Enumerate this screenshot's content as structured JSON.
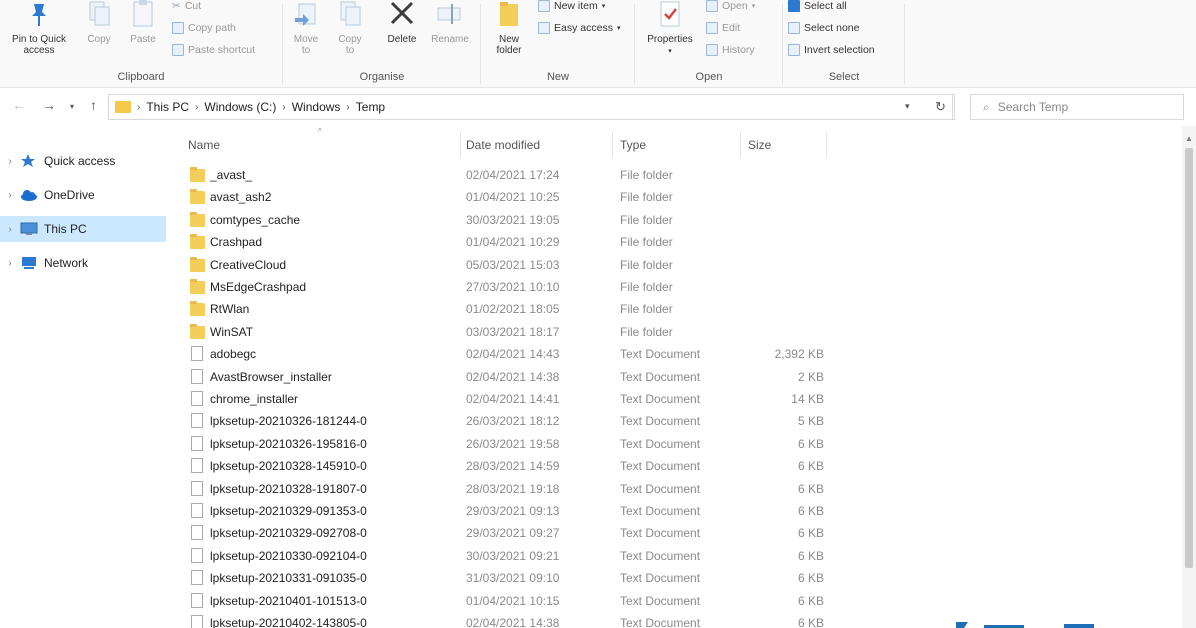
{
  "ribbon": {
    "clipboard": {
      "label": "Clipboard",
      "pin_label_1": "Pin to Quick",
      "pin_label_2": "access",
      "copy": "Copy",
      "paste": "Paste",
      "cut": "Cut",
      "copy_path": "Copy path",
      "paste_shortcut": "Paste shortcut"
    },
    "organise": {
      "label": "Organise",
      "move_to_1": "Move",
      "move_to_2": "to",
      "copy_to_1": "Copy",
      "copy_to_2": "to",
      "delete": "Delete",
      "rename": "Rename"
    },
    "new": {
      "label": "New",
      "new_folder_1": "New",
      "new_folder_2": "folder",
      "new_item": "New item",
      "easy_access": "Easy access"
    },
    "open": {
      "label": "Open",
      "properties": "Properties",
      "open": "Open",
      "edit": "Edit",
      "history": "History"
    },
    "select": {
      "label": "Select",
      "select_all": "Select all",
      "select_none": "Select none",
      "invert_selection": "Invert selection"
    }
  },
  "address": {
    "crumbs": [
      "This PC",
      "Windows (C:)",
      "Windows",
      "Temp"
    ],
    "search_placeholder": "Search Temp"
  },
  "navpane": {
    "items": [
      {
        "label": "Quick access",
        "icon": "star-icon"
      },
      {
        "label": "OneDrive",
        "icon": "cloud-icon"
      },
      {
        "label": "This PC",
        "icon": "computer-icon"
      },
      {
        "label": "Network",
        "icon": "network-icon"
      }
    ]
  },
  "columns": {
    "name": "Name",
    "date": "Date modified",
    "type": "Type",
    "size": "Size"
  },
  "files": [
    {
      "name": "_avast_",
      "date": "02/04/2021 17:24",
      "type": "File folder",
      "size": "",
      "kind": "folder"
    },
    {
      "name": "avast_ash2",
      "date": "01/04/2021 10:25",
      "type": "File folder",
      "size": "",
      "kind": "folder"
    },
    {
      "name": "comtypes_cache",
      "date": "30/03/2021 19:05",
      "type": "File folder",
      "size": "",
      "kind": "folder"
    },
    {
      "name": "Crashpad",
      "date": "01/04/2021 10:29",
      "type": "File folder",
      "size": "",
      "kind": "folder"
    },
    {
      "name": "CreativeCloud",
      "date": "05/03/2021 15:03",
      "type": "File folder",
      "size": "",
      "kind": "folder"
    },
    {
      "name": "MsEdgeCrashpad",
      "date": "27/03/2021 10:10",
      "type": "File folder",
      "size": "",
      "kind": "folder"
    },
    {
      "name": "RtWlan",
      "date": "01/02/2021 18:05",
      "type": "File folder",
      "size": "",
      "kind": "folder"
    },
    {
      "name": "WinSAT",
      "date": "03/03/2021 18:17",
      "type": "File folder",
      "size": "",
      "kind": "folder"
    },
    {
      "name": "adobegc",
      "date": "02/04/2021 14:43",
      "type": "Text Document",
      "size": "2,392 KB",
      "kind": "doc"
    },
    {
      "name": "AvastBrowser_installer",
      "date": "02/04/2021 14:38",
      "type": "Text Document",
      "size": "2 KB",
      "kind": "doc"
    },
    {
      "name": "chrome_installer",
      "date": "02/04/2021 14:41",
      "type": "Text Document",
      "size": "14 KB",
      "kind": "doc"
    },
    {
      "name": "lpksetup-20210326-181244-0",
      "date": "26/03/2021 18:12",
      "type": "Text Document",
      "size": "5 KB",
      "kind": "doc"
    },
    {
      "name": "lpksetup-20210326-195816-0",
      "date": "26/03/2021 19:58",
      "type": "Text Document",
      "size": "6 KB",
      "kind": "doc"
    },
    {
      "name": "lpksetup-20210328-145910-0",
      "date": "28/03/2021 14:59",
      "type": "Text Document",
      "size": "6 KB",
      "kind": "doc"
    },
    {
      "name": "lpksetup-20210328-191807-0",
      "date": "28/03/2021 19:18",
      "type": "Text Document",
      "size": "6 KB",
      "kind": "doc"
    },
    {
      "name": "lpksetup-20210329-091353-0",
      "date": "29/03/2021 09:13",
      "type": "Text Document",
      "size": "6 KB",
      "kind": "doc"
    },
    {
      "name": "lpksetup-20210329-092708-0",
      "date": "29/03/2021 09:27",
      "type": "Text Document",
      "size": "6 KB",
      "kind": "doc"
    },
    {
      "name": "lpksetup-20210330-092104-0",
      "date": "30/03/2021 09:21",
      "type": "Text Document",
      "size": "6 KB",
      "kind": "doc"
    },
    {
      "name": "lpksetup-20210331-091035-0",
      "date": "31/03/2021 09:10",
      "type": "Text Document",
      "size": "6 KB",
      "kind": "doc"
    },
    {
      "name": "lpksetup-20210401-101513-0",
      "date": "01/04/2021 10:15",
      "type": "Text Document",
      "size": "6 KB",
      "kind": "doc"
    },
    {
      "name": "lpksetup-20210402-143805-0",
      "date": "02/04/2021 14:38",
      "type": "Text Document",
      "size": "6 KB",
      "kind": "doc"
    }
  ],
  "colors": {
    "folder": "#f5cd5b",
    "selected": "#cce8ff",
    "accent": "#2b79d1"
  }
}
